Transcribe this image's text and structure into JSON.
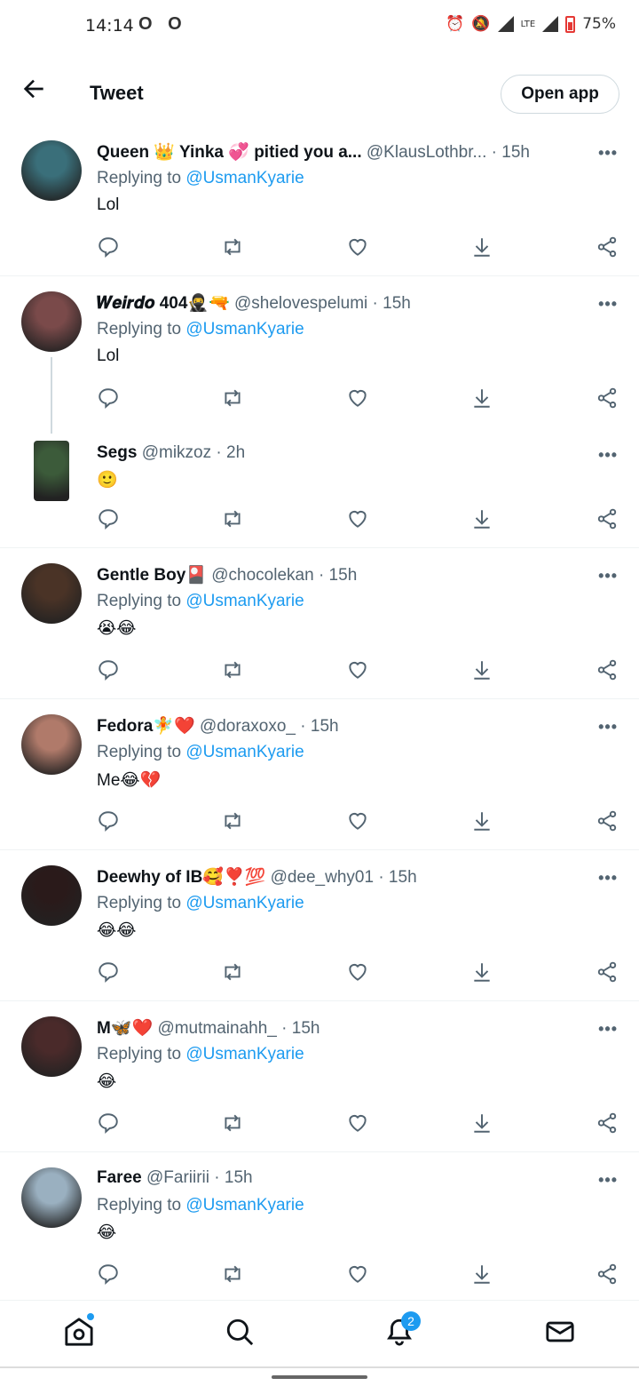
{
  "status_bar": {
    "time": "14:14",
    "left_icons": "O O",
    "battery": "75%",
    "network": "LTE"
  },
  "header": {
    "title": "Tweet",
    "open_app": "Open app"
  },
  "replying_label": "Replying to",
  "replying_handle": "@UsmanKyarie",
  "tweets": [
    {
      "name": "Queen 👑 Yinka 💞 pitied you a...",
      "handle": "@KlausLothbr...",
      "time": "· 15h",
      "text": "Lol",
      "replying": true
    },
    {
      "name": "𝑾𝒆𝒊𝒓𝒅𝒐 404🥷🔫",
      "handle": "@shelovespelumi",
      "time": "· 15h",
      "text": "Lol",
      "replying": true
    },
    {
      "name": "Segs",
      "handle": "@mikzoz",
      "time": "· 2h",
      "text": "🙂",
      "replying": false
    },
    {
      "name": "Gentle Boy🎴",
      "handle": "@chocolekan",
      "time": "· 15h",
      "text": "😭😂",
      "replying": true
    },
    {
      "name": "Fedora🧚❤️",
      "handle": "@doraxoxo_",
      "time": "· 15h",
      "text": "Me😂💔",
      "replying": true
    },
    {
      "name": "Deewhy of IB🥰❣️💯",
      "handle": "@dee_why01",
      "time": "· 15h",
      "text": "😂😂",
      "replying": true
    },
    {
      "name": "M🦋❤️",
      "handle": "@mutmainahh_",
      "time": "· 15h",
      "text": "😂",
      "replying": true
    },
    {
      "name": "Faree",
      "handle": "@Fariirii",
      "time": "· 15h",
      "text": "😂",
      "replying": true
    }
  ],
  "more_label": "•••",
  "notifications_badge": "2",
  "colors": {
    "accent": "#1d9bf0",
    "text": "#0f1419",
    "meta": "#536471"
  }
}
